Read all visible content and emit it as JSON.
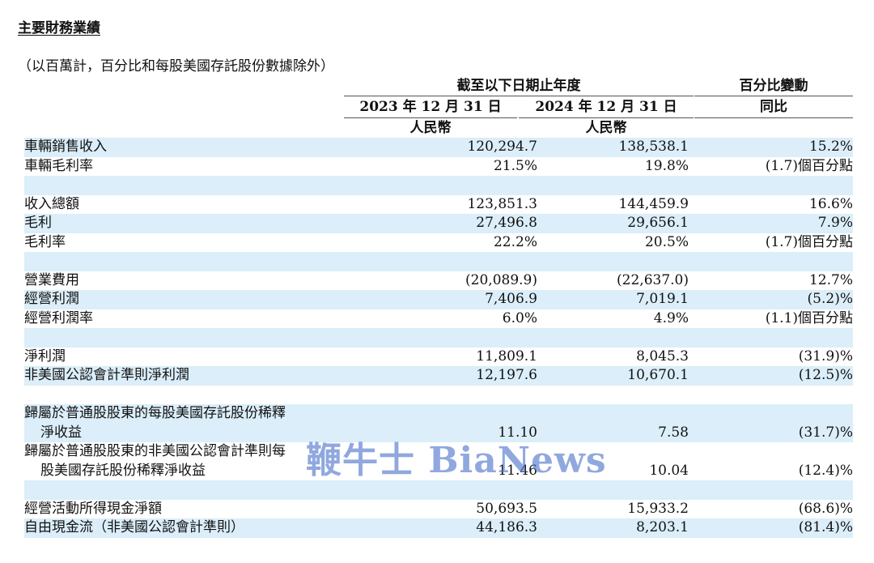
{
  "title": "主要財務業績",
  "note": "（以百萬計，百分比和每股美國存託股份數據除外）",
  "header": {
    "group_period": "截至以下日期止年度",
    "group_change": "百分比變動",
    "col1_date": "2023 年 12 月 31 日",
    "col2_date": "2024 年 12 月 31 日",
    "col3_label": "同比",
    "col1_currency": "人民幣",
    "col2_currency": "人民幣"
  },
  "rows": [
    {
      "label": "車輛銷售收入",
      "v1": "120,294.7",
      "v2": "138,538.1",
      "v3": "15.2%",
      "shade": true
    },
    {
      "label": "車輛毛利率",
      "v1": "21.5%",
      "v2": "19.8%",
      "v3": "(1.7)個百分點",
      "shade": false
    },
    {
      "label": "",
      "v1": "",
      "v2": "",
      "v3": "",
      "shade": true
    },
    {
      "label": "收入總額",
      "v1": "123,851.3",
      "v2": "144,459.9",
      "v3": "16.6%",
      "shade": false
    },
    {
      "label": "毛利",
      "v1": "27,496.8",
      "v2": "29,656.1",
      "v3": "7.9%",
      "shade": true
    },
    {
      "label": "毛利率",
      "v1": "22.2%",
      "v2": "20.5%",
      "v3": "(1.7)個百分點",
      "shade": false
    },
    {
      "label": "",
      "v1": "",
      "v2": "",
      "v3": "",
      "shade": true
    },
    {
      "label": "營業費用",
      "v1": "(20,089.9)",
      "v2": "(22,637.0)",
      "v3": "12.7%",
      "shade": false
    },
    {
      "label": "經營利潤",
      "v1": "7,406.9",
      "v2": "7,019.1",
      "v3": "(5.2)%",
      "shade": true
    },
    {
      "label": "經營利潤率",
      "v1": "6.0%",
      "v2": "4.9%",
      "v3": "(1.1)個百分點",
      "shade": false
    },
    {
      "label": "",
      "v1": "",
      "v2": "",
      "v3": "",
      "shade": true
    },
    {
      "label": "淨利潤",
      "v1": "11,809.1",
      "v2": "8,045.3",
      "v3": "(31.9)%",
      "shade": false
    },
    {
      "label": "非美國公認會計準則淨利潤",
      "v1": "12,197.6",
      "v2": "10,670.1",
      "v3": "(12.5)%",
      "shade": true
    },
    {
      "label": "",
      "v1": "",
      "v2": "",
      "v3": "",
      "shade": false
    },
    {
      "label": "歸屬於普通股股東的每股美國存託股份稀釋",
      "v1": "",
      "v2": "",
      "v3": "",
      "shade": true
    },
    {
      "label": "淨收益",
      "indent": true,
      "v1": "11.10",
      "v2": "7.58",
      "v3": "(31.7)%",
      "shade": true
    },
    {
      "label": "歸屬於普通股股東的非美國公認會計準則每",
      "v1": "",
      "v2": "",
      "v3": "",
      "shade": false
    },
    {
      "label": "股美國存託股份稀釋淨收益",
      "indent": true,
      "v1": "11.46",
      "v2": "10.04",
      "v3": "(12.4)%",
      "shade": false
    },
    {
      "label": "",
      "v1": "",
      "v2": "",
      "v3": "",
      "shade": true
    },
    {
      "label": "經營活動所得現金淨額",
      "v1": "50,693.5",
      "v2": "15,933.2",
      "v3": "(68.6)%",
      "shade": false
    },
    {
      "label": "自由現金流（非美國公認會計準則）",
      "v1": "44,186.3",
      "v2": "8,203.1",
      "v3": "(81.4)%",
      "shade": true
    }
  ],
  "watermark": "鞭牛士 BiaNews"
}
